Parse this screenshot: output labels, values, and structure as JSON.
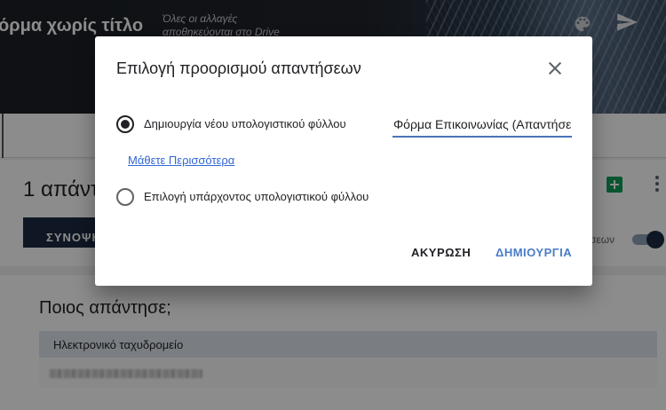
{
  "header": {
    "form_title": "όρμα χωρίς τίτλο",
    "save_status": "Όλες οι αλλαγές αποθηκεύονται στο Drive",
    "icons": [
      "palette-icon",
      "send-icon"
    ]
  },
  "summary": {
    "responses_count": "1 απάντ",
    "summary_button": "ΣΥΝΟΨΗ",
    "accepting_label": "σεων"
  },
  "who": {
    "title": "Ποιος απάντησε;",
    "email_header": "Ηλεκτρονικό ταχυδρομείο"
  },
  "dialog": {
    "title": "Επιλογή προορισμού απαντήσεων",
    "option_new_label": "Δημιουργία νέου υπολογιστικού φύλλου",
    "sheet_name_value": "Φόρμα Επικοινωνίας (Απαντήσεις)",
    "learn_more": "Μάθετε Περισσότερα",
    "option_existing_label": "Επιλογή υπάρχοντος υπολογιστικού φύλλου",
    "cancel_label": "ΑΚΥΡΩΣΗ",
    "create_label": "ΔΗΜΙΟΥΡΓΙΑ",
    "selected_option": "new"
  },
  "colors": {
    "accent": "#4a7cc6",
    "link": "#3367d6",
    "dark_button": "#1c2b42",
    "sheets_green": "#0f9d58"
  }
}
